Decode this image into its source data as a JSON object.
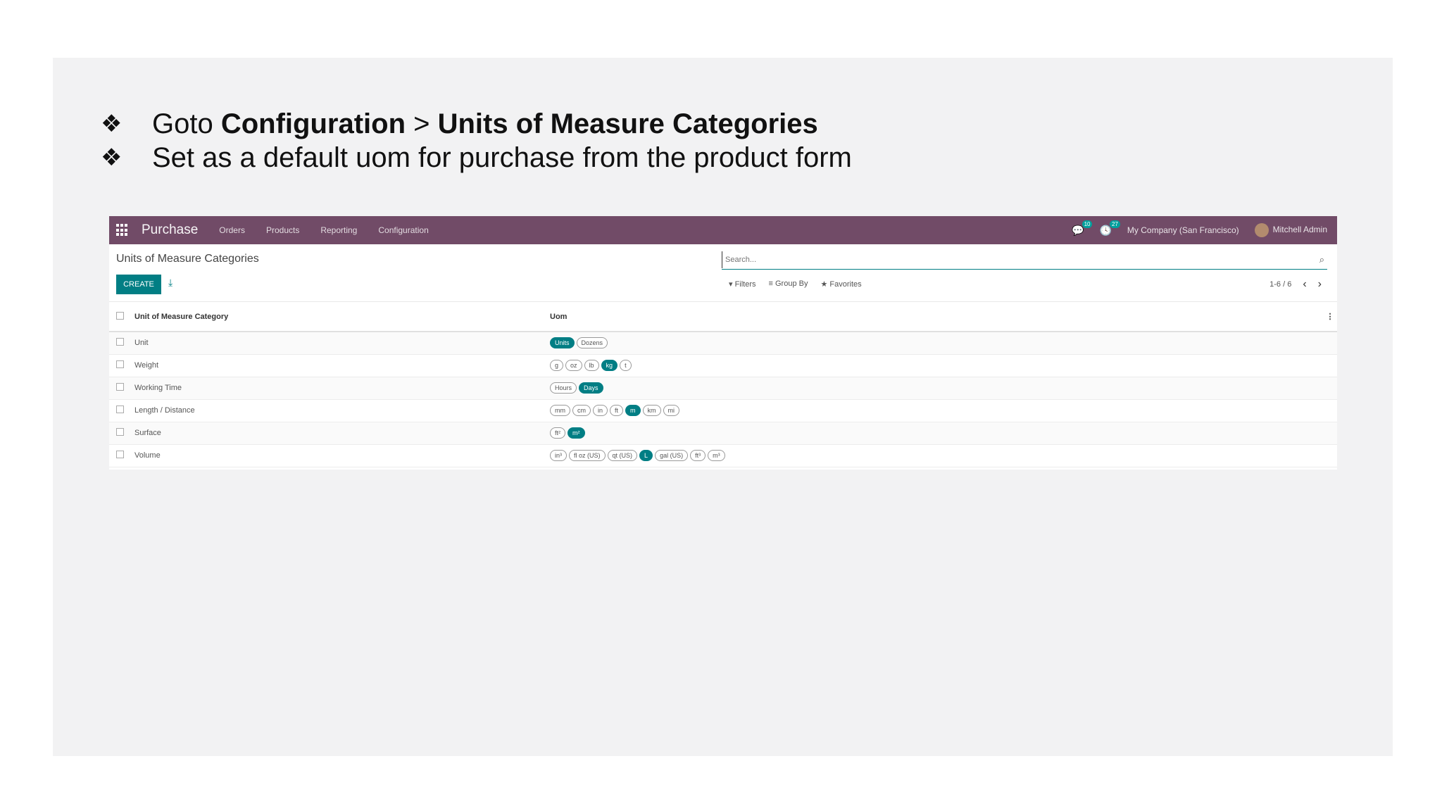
{
  "slide": {
    "bullet1": {
      "mark": "❖",
      "prefix": "Goto ",
      "bold1": "Configuration",
      "sep": " > ",
      "bold2": "Units of Measure Categories"
    },
    "bullet2": {
      "mark": "❖",
      "text": "Set as a default uom for purchase from the product form"
    }
  },
  "navbar": {
    "brand": "Purchase",
    "menus": [
      "Orders",
      "Products",
      "Reporting",
      "Configuration"
    ],
    "chat_count": "10",
    "activity_count": "27",
    "company": "My Company (San Francisco)",
    "user": "Mitchell Admin"
  },
  "control": {
    "title": "Units of Measure Categories",
    "create_label": "CREATE",
    "search_placeholder": "Search...",
    "filters_label": "▾ Filters",
    "groupby_label": "≡ Group By",
    "favorites_label": "★ Favorites",
    "pager": "1-6 / 6"
  },
  "table": {
    "headers": [
      "Unit of Measure Category",
      "Uom"
    ],
    "rows": [
      {
        "name": "Unit",
        "uoms": [
          {
            "label": "Units",
            "active": true
          },
          {
            "label": "Dozens",
            "active": false
          }
        ]
      },
      {
        "name": "Weight",
        "uoms": [
          {
            "label": "g",
            "active": false
          },
          {
            "label": "oz",
            "active": false
          },
          {
            "label": "lb",
            "active": false
          },
          {
            "label": "kg",
            "active": true
          },
          {
            "label": "t",
            "active": false
          }
        ]
      },
      {
        "name": "Working Time",
        "uoms": [
          {
            "label": "Hours",
            "active": false
          },
          {
            "label": "Days",
            "active": true
          }
        ]
      },
      {
        "name": "Length / Distance",
        "uoms": [
          {
            "label": "mm",
            "active": false
          },
          {
            "label": "cm",
            "active": false
          },
          {
            "label": "in",
            "active": false
          },
          {
            "label": "ft",
            "active": false
          },
          {
            "label": "m",
            "active": true
          },
          {
            "label": "km",
            "active": false
          },
          {
            "label": "mi",
            "active": false
          }
        ]
      },
      {
        "name": "Surface",
        "uoms": [
          {
            "label": "ft²",
            "active": false
          },
          {
            "label": "m²",
            "active": true
          }
        ]
      },
      {
        "name": "Volume",
        "uoms": [
          {
            "label": "in³",
            "active": false
          },
          {
            "label": "fl oz (US)",
            "active": false
          },
          {
            "label": "qt (US)",
            "active": false
          },
          {
            "label": "L",
            "active": true
          },
          {
            "label": "gal (US)",
            "active": false
          },
          {
            "label": "ft³",
            "active": false
          },
          {
            "label": "m³",
            "active": false
          }
        ]
      }
    ]
  }
}
